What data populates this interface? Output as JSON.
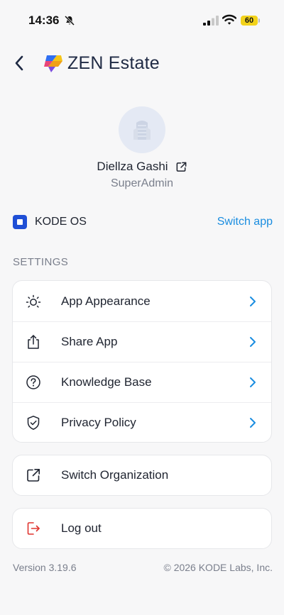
{
  "status_bar": {
    "time": "14:36",
    "battery": "60",
    "icons": [
      "bell-slash-icon",
      "cellular-signal-icon",
      "wifi-icon",
      "battery-icon"
    ]
  },
  "header": {
    "title": "ZEN Estate",
    "back_icon": "chevron-left-icon",
    "logo_icon": "zen-estate-logo"
  },
  "profile": {
    "name": "Diellza Gashi",
    "role": "SuperAdmin",
    "avatar_icon": "building-avatar-icon",
    "link_icon": "external-link-icon"
  },
  "app": {
    "name": "KODE OS",
    "switch_label": "Switch app",
    "icon": "kode-os-icon"
  },
  "settings": {
    "title": "SETTINGS",
    "items": [
      {
        "label": "App Appearance",
        "icon": "sun-icon"
      },
      {
        "label": "Share App",
        "icon": "share-icon"
      },
      {
        "label": "Knowledge Base",
        "icon": "question-circle-icon"
      },
      {
        "label": "Privacy Policy",
        "icon": "shield-check-icon"
      }
    ]
  },
  "organization": {
    "label": "Switch Organization",
    "icon": "external-link-icon"
  },
  "logout": {
    "label": "Log out",
    "icon": "logout-icon"
  },
  "footer": {
    "version": "Version 3.19.6",
    "copyright": "© 2026 KODE Labs, Inc."
  },
  "colors": {
    "accent": "#1a8de0",
    "background": "#f7f7f8",
    "logout_red": "#e0342f",
    "kode_blue": "#1f4fd6"
  }
}
